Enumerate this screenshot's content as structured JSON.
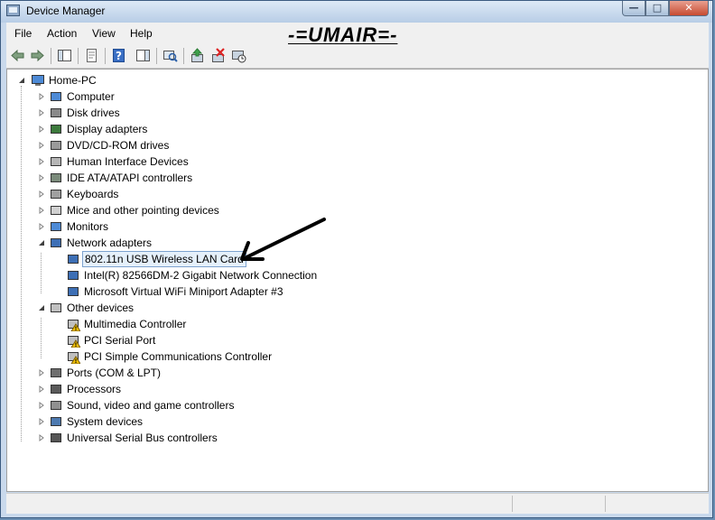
{
  "window": {
    "title": "Device Manager",
    "minimize": "—",
    "maximize": "□",
    "close": "✕"
  },
  "menu": {
    "file": "File",
    "action": "Action",
    "view": "View",
    "help": "Help"
  },
  "watermark": "-=UMAIR=-",
  "tree": {
    "root": "Home-PC",
    "items": [
      {
        "label": "Computer",
        "icon": "computer-icon"
      },
      {
        "label": "Disk drives",
        "icon": "disk-drive-icon"
      },
      {
        "label": "Display adapters",
        "icon": "display-adapter-icon"
      },
      {
        "label": "DVD/CD-ROM drives",
        "icon": "dvd-drive-icon"
      },
      {
        "label": "Human Interface Devices",
        "icon": "hid-icon"
      },
      {
        "label": "IDE ATA/ATAPI controllers",
        "icon": "ide-controller-icon"
      },
      {
        "label": "Keyboards",
        "icon": "keyboard-icon"
      },
      {
        "label": "Mice and other pointing devices",
        "icon": "mouse-icon"
      },
      {
        "label": "Monitors",
        "icon": "monitor-icon"
      },
      {
        "label": "Network adapters",
        "icon": "network-adapter-icon"
      },
      {
        "label": "Other devices",
        "icon": "unknown-device-icon"
      },
      {
        "label": "Ports (COM & LPT)",
        "icon": "port-icon"
      },
      {
        "label": "Processors",
        "icon": "processor-icon"
      },
      {
        "label": "Sound, video and game controllers",
        "icon": "sound-icon"
      },
      {
        "label": "System devices",
        "icon": "system-device-icon"
      },
      {
        "label": "Universal Serial Bus controllers",
        "icon": "usb-icon"
      }
    ],
    "network_children": [
      "802.11n USB Wireless LAN Card",
      "Intel(R) 82566DM-2 Gigabit Network Connection",
      "Microsoft Virtual WiFi Miniport Adapter #3"
    ],
    "other_children": [
      "Multimedia Controller",
      "PCI Serial Port",
      "PCI Simple Communications Controller"
    ]
  }
}
